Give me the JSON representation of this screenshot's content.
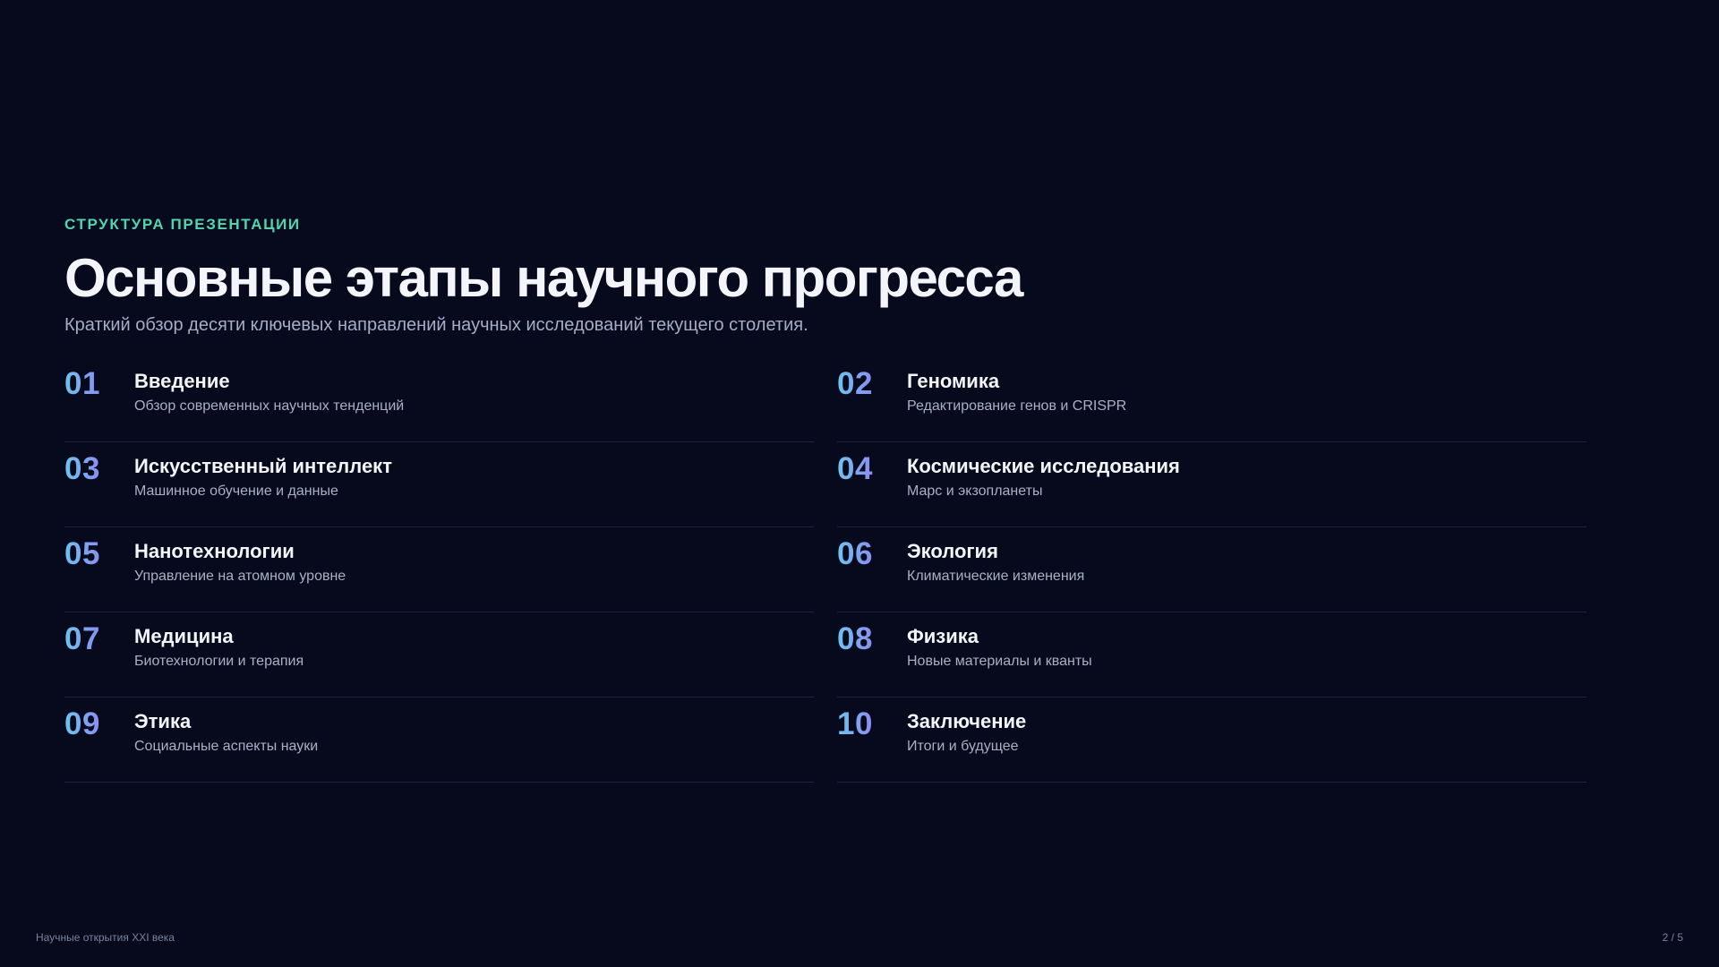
{
  "header": {
    "eyebrow": "СТРУКТУРА ПРЕЗЕНТАЦИИ",
    "title": "Основные этапы научного прогресса",
    "subtitle": "Краткий обзор десяти ключевых направлений научных исследований текущего столетия."
  },
  "items": [
    {
      "number": "01",
      "title": "Введение",
      "description": "Обзор современных научных тенденций"
    },
    {
      "number": "02",
      "title": "Геномика",
      "description": "Редактирование генов и CRISPR"
    },
    {
      "number": "03",
      "title": "Искусственный интеллект",
      "description": "Машинное обучение и данные"
    },
    {
      "number": "04",
      "title": "Космические исследования",
      "description": "Марс и экзопланеты"
    },
    {
      "number": "05",
      "title": "Нанотехнологии",
      "description": "Управление на атомном уровне"
    },
    {
      "number": "06",
      "title": "Экология",
      "description": "Климатические изменения"
    },
    {
      "number": "07",
      "title": "Медицина",
      "description": "Биотехнологии и терапия"
    },
    {
      "number": "08",
      "title": "Физика",
      "description": "Новые материалы и кванты"
    },
    {
      "number": "09",
      "title": "Этика",
      "description": "Социальные аспекты науки"
    },
    {
      "number": "10",
      "title": "Заключение",
      "description": "Итоги и будущее"
    }
  ],
  "footer": {
    "presentation_name": "Научные открытия XXI века",
    "page_indicator": "2 / 5"
  },
  "colors": {
    "background": "#060a1c",
    "accent_eyebrow": "#4fd6b0",
    "number_gradient_start": "#6ec4ee",
    "number_gradient_end": "#8b8df0",
    "title_text": "#f3f5fb",
    "muted_text": "#a4adc8"
  }
}
